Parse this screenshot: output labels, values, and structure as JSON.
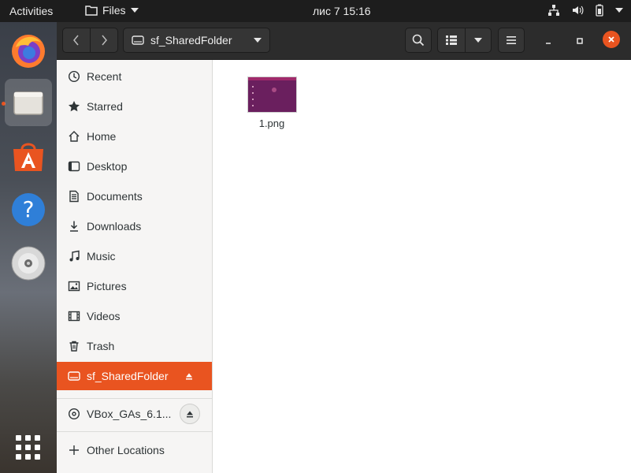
{
  "topbar": {
    "activities": "Activities",
    "app_name": "Files",
    "clock": "лис 7  15:16"
  },
  "window": {
    "path_label": "sf_SharedFolder"
  },
  "sidebar": {
    "items": [
      {
        "label": "Recent",
        "icon": "clock-icon"
      },
      {
        "label": "Starred",
        "icon": "star-icon"
      },
      {
        "label": "Home",
        "icon": "home-icon"
      },
      {
        "label": "Desktop",
        "icon": "desktop-icon"
      },
      {
        "label": "Documents",
        "icon": "document-icon"
      },
      {
        "label": "Downloads",
        "icon": "download-icon"
      },
      {
        "label": "Music",
        "icon": "music-icon"
      },
      {
        "label": "Pictures",
        "icon": "picture-icon"
      },
      {
        "label": "Videos",
        "icon": "video-icon"
      },
      {
        "label": "Trash",
        "icon": "trash-icon"
      }
    ],
    "shared_folder": "sf_SharedFolder",
    "vbox": "VBox_GAs_6.1...",
    "other_locations": "Other Locations"
  },
  "files": [
    {
      "name": "1.png"
    }
  ],
  "colors": {
    "accent": "#e95420",
    "topbar": "#1d1d1d",
    "headerbar": "#2c2c2c",
    "sidebar": "#f6f5f4"
  }
}
